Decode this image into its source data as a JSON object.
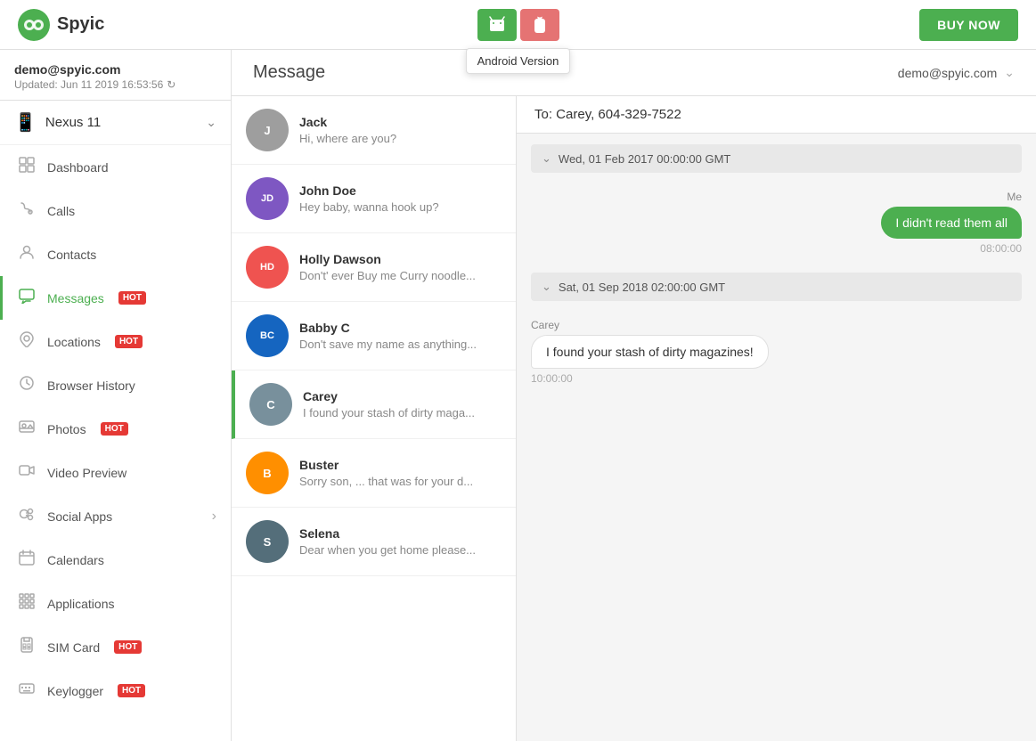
{
  "header": {
    "logo_text": "Spyic",
    "android_tooltip": "Android Version",
    "buy_button": "BUY NOW",
    "user_email_header": "demo@spyic.com"
  },
  "sidebar": {
    "user_email": "demo@spyic.com",
    "updated_label": "Updated: Jun 11 2019 16:53:56",
    "device_name": "Nexus 11",
    "nav_items": [
      {
        "id": "dashboard",
        "label": "Dashboard",
        "icon": "○",
        "hot": false,
        "has_arrow": false
      },
      {
        "id": "calls",
        "label": "Calls",
        "icon": "☎",
        "hot": false,
        "has_arrow": false
      },
      {
        "id": "contacts",
        "label": "Contacts",
        "icon": "👤",
        "hot": false,
        "has_arrow": false
      },
      {
        "id": "messages",
        "label": "Messages",
        "icon": "💬",
        "hot": true,
        "has_arrow": false,
        "active": true
      },
      {
        "id": "locations",
        "label": "Locations",
        "icon": "◎",
        "hot": true,
        "has_arrow": false
      },
      {
        "id": "browser-history",
        "label": "Browser History",
        "icon": "⏱",
        "hot": false,
        "has_arrow": false
      },
      {
        "id": "photos",
        "label": "Photos",
        "icon": "🖼",
        "hot": true,
        "has_arrow": false
      },
      {
        "id": "video-preview",
        "label": "Video Preview",
        "icon": "▣",
        "hot": false,
        "has_arrow": false
      },
      {
        "id": "social-apps",
        "label": "Social Apps",
        "icon": "💬",
        "hot": false,
        "has_arrow": true
      },
      {
        "id": "calendars",
        "label": "Calendars",
        "icon": "📅",
        "hot": false,
        "has_arrow": false
      },
      {
        "id": "applications",
        "label": "Applications",
        "icon": "⊞",
        "hot": false,
        "has_arrow": false
      },
      {
        "id": "sim-card",
        "label": "SIM Card",
        "icon": "▤",
        "hot": true,
        "has_arrow": false
      },
      {
        "id": "keylogger",
        "label": "Keylogger",
        "icon": "⌨",
        "hot": true,
        "has_arrow": false
      }
    ]
  },
  "message_panel": {
    "title": "Message",
    "to_label": "To: Carey, 604-329-7522",
    "conversations": [
      {
        "id": 1,
        "name": "Jack",
        "preview": "Hi, where are you?",
        "color": "#9e9e9e",
        "initials": "J",
        "active": false
      },
      {
        "id": 2,
        "name": "John Doe",
        "preview": "Hey baby, wanna hook up?",
        "color": "#7e57c2",
        "initials": "JD",
        "active": false
      },
      {
        "id": 3,
        "name": "Holly Dawson",
        "preview": "Don't' ever Buy me Curry noodle...",
        "color": "#ef5350",
        "initials": "HD",
        "active": false
      },
      {
        "id": 4,
        "name": "Babby C",
        "preview": "Don't save my name as anything...",
        "color": "#1565c0",
        "initials": "BC",
        "active": false
      },
      {
        "id": 5,
        "name": "Carey",
        "preview": "I found your stash of dirty maga...",
        "color": "#78909c",
        "initials": "C",
        "active": true
      },
      {
        "id": 6,
        "name": "Buster",
        "preview": "Sorry son, ... that was for your d...",
        "color": "#ff8f00",
        "initials": "B",
        "active": false
      },
      {
        "id": 7,
        "name": "Selena",
        "preview": "Dear when you get home please...",
        "color": "#546e7a",
        "initials": "S",
        "active": false
      }
    ],
    "date_dividers": [
      {
        "id": 1,
        "label": "Wed, 01 Feb 2017 00:00:00 GMT"
      },
      {
        "id": 2,
        "label": "Sat, 01 Sep 2018 02:00:00 GMT"
      }
    ],
    "messages": [
      {
        "id": 1,
        "sender": "Me",
        "text": "I didn't read them all",
        "time": "08:00:00",
        "direction": "right",
        "date_divider": "Wed, 01 Feb 2017 00:00:00 GMT"
      },
      {
        "id": 2,
        "sender": "Carey",
        "text": "I found your stash of dirty magazines!",
        "time": "10:00:00",
        "direction": "left",
        "date_divider": "Sat, 01 Sep 2018 02:00:00 GMT"
      }
    ]
  }
}
